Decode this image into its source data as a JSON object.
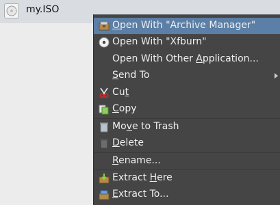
{
  "file": {
    "name": "my.ISO",
    "icon": "disc-image-icon"
  },
  "menu": {
    "items": [
      {
        "label": "Open With \"Archive Manager\"",
        "icon": "archive-manager-icon",
        "accel_index": 0
      },
      {
        "label": "Open With \"Xfburn\"",
        "icon": "xfburn-disc-icon",
        "accel_index": -1
      },
      {
        "label": "Open With Other Application...",
        "icon": "",
        "accel_index": 16
      },
      {
        "label": "Send To",
        "icon": "",
        "accel_index": 0,
        "submenu": true
      },
      {
        "label": "Cut",
        "icon": "scissors-icon",
        "accel_index": 2
      },
      {
        "label": "Copy",
        "icon": "copy-icon",
        "accel_index": 0
      },
      {
        "label": "Move to Trash",
        "icon": "trash-icon",
        "accel_index": 2
      },
      {
        "label": "Delete",
        "icon": "delete-icon",
        "accel_index": 0
      },
      {
        "label": "Rename...",
        "icon": "",
        "accel_index": 0
      },
      {
        "label": "Extract Here",
        "icon": "extract-here-icon",
        "accel_index": 8
      },
      {
        "label": "Extract To...",
        "icon": "extract-to-icon",
        "accel_index": 0
      }
    ]
  },
  "colors": {
    "menu_bg": "#454545",
    "highlight": "#5b7fa6",
    "text": "#efefef"
  }
}
